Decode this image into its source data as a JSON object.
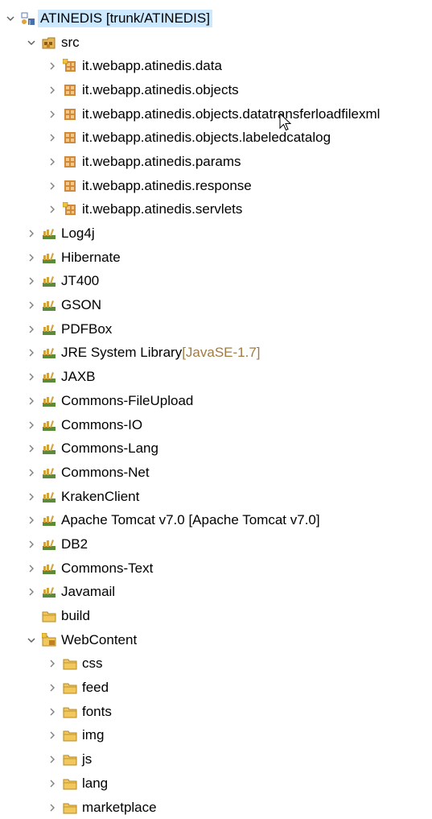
{
  "colors": {
    "selection": "#cce8ff",
    "decoration": "#a07a43",
    "twisty": "#808080",
    "package": "#b07a2a",
    "jar": "#c9a43a",
    "folder": "#d7a64a"
  },
  "project": {
    "label": "ATINEDIS",
    "decoration": " [trunk/ATINEDIS]",
    "expanded": true,
    "icon": "java-project-icon",
    "selected": true
  },
  "tree": [
    {
      "label": "src",
      "level": 1,
      "icon": "source-folder",
      "twisty": "expanded"
    },
    {
      "label": "it.webapp.atinedis.data",
      "level": 2,
      "icon": "package-versioned",
      "twisty": "collapsed"
    },
    {
      "label": "it.webapp.atinedis.objects",
      "level": 2,
      "icon": "package",
      "twisty": "collapsed"
    },
    {
      "label": "it.webapp.atinedis.objects.datatransferloadfilexml",
      "level": 2,
      "icon": "package",
      "twisty": "collapsed"
    },
    {
      "label": "it.webapp.atinedis.objects.labeledcatalog",
      "level": 2,
      "icon": "package",
      "twisty": "collapsed"
    },
    {
      "label": "it.webapp.atinedis.params",
      "level": 2,
      "icon": "package",
      "twisty": "collapsed"
    },
    {
      "label": "it.webapp.atinedis.response",
      "level": 2,
      "icon": "package",
      "twisty": "collapsed"
    },
    {
      "label": "it.webapp.atinedis.servlets",
      "level": 2,
      "icon": "package-versioned",
      "twisty": "collapsed"
    },
    {
      "label": "Log4j",
      "level": 1,
      "icon": "library",
      "twisty": "collapsed"
    },
    {
      "label": "Hibernate",
      "level": 1,
      "icon": "library",
      "twisty": "collapsed"
    },
    {
      "label": "JT400",
      "level": 1,
      "icon": "library",
      "twisty": "collapsed"
    },
    {
      "label": "GSON",
      "level": 1,
      "icon": "library",
      "twisty": "collapsed"
    },
    {
      "label": "PDFBox",
      "level": 1,
      "icon": "library",
      "twisty": "collapsed"
    },
    {
      "label": "JRE System Library",
      "decoration": " [JavaSE-1.7]",
      "level": 1,
      "icon": "library",
      "twisty": "collapsed"
    },
    {
      "label": "JAXB",
      "level": 1,
      "icon": "library",
      "twisty": "collapsed"
    },
    {
      "label": "Commons-FileUpload",
      "level": 1,
      "icon": "library",
      "twisty": "collapsed"
    },
    {
      "label": "Commons-IO",
      "level": 1,
      "icon": "library",
      "twisty": "collapsed"
    },
    {
      "label": "Commons-Lang",
      "level": 1,
      "icon": "library",
      "twisty": "collapsed"
    },
    {
      "label": "Commons-Net",
      "level": 1,
      "icon": "library",
      "twisty": "collapsed"
    },
    {
      "label": "KrakenClient",
      "level": 1,
      "icon": "library",
      "twisty": "collapsed"
    },
    {
      "label": "Apache Tomcat v7.0 [Apache Tomcat v7.0]",
      "level": 1,
      "icon": "library",
      "twisty": "collapsed"
    },
    {
      "label": "DB2",
      "level": 1,
      "icon": "library",
      "twisty": "collapsed"
    },
    {
      "label": "Commons-Text",
      "level": 1,
      "icon": "library",
      "twisty": "collapsed"
    },
    {
      "label": "Javamail",
      "level": 1,
      "icon": "library",
      "twisty": "collapsed"
    },
    {
      "label": "build",
      "level": 1,
      "icon": "folder",
      "twisty": "none"
    },
    {
      "label": "WebContent",
      "level": 1,
      "icon": "folder-versioned",
      "twisty": "expanded"
    },
    {
      "label": "css",
      "level": 2,
      "icon": "folder",
      "twisty": "collapsed"
    },
    {
      "label": "feed",
      "level": 2,
      "icon": "folder",
      "twisty": "collapsed"
    },
    {
      "label": "fonts",
      "level": 2,
      "icon": "folder",
      "twisty": "collapsed"
    },
    {
      "label": "img",
      "level": 2,
      "icon": "folder",
      "twisty": "collapsed"
    },
    {
      "label": "js",
      "level": 2,
      "icon": "folder",
      "twisty": "collapsed"
    },
    {
      "label": "lang",
      "level": 2,
      "icon": "folder",
      "twisty": "collapsed"
    },
    {
      "label": "marketplace",
      "level": 2,
      "icon": "folder",
      "twisty": "collapsed"
    }
  ]
}
